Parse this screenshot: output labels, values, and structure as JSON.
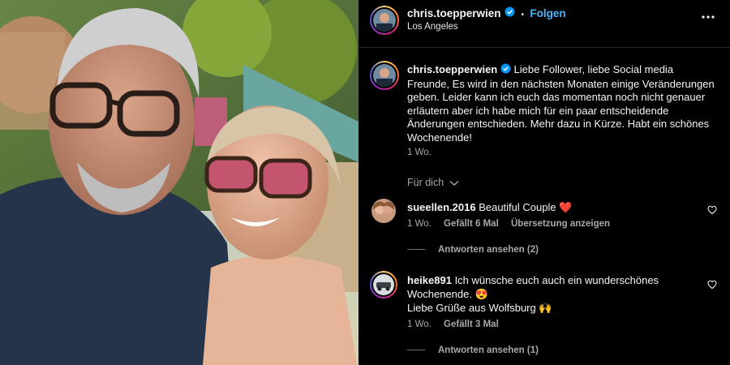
{
  "post": {
    "author": "chris.toepperwien",
    "follow_label": "Folgen",
    "separator": "•",
    "location": "Los Angeles",
    "more_label": "•••"
  },
  "caption": {
    "author": "chris.toepperwien",
    "text": "Liebe Follower, liebe Social media Freunde, Es wird in den nächsten Monaten einige Veränderungen geben. Leider kann ich euch das momentan noch nicht genauer erläutern aber ich habe mich für ein paar entscheidende Änderungen entschieden. Mehr dazu in Kürze. Habt ein schönes Wochenende!",
    "time": "1 Wo."
  },
  "for_you": "Für dich",
  "comments": [
    {
      "user": "sueellen.2016",
      "text": "Beautiful Couple ❤️",
      "time": "1 Wo.",
      "likes": "Gefällt 6 Mal",
      "translate": "Übersetzung anzeigen",
      "replies": "Antworten ansehen (2)"
    },
    {
      "user": "heike891",
      "text_line1": "Ich wünsche euch auch ein wunderschönes",
      "text_line2": "Wochenende. 😍",
      "text_line3": "Liebe Grüße aus Wolfsburg 🙌",
      "time": "1 Wo.",
      "likes": "Gefällt 3 Mal",
      "replies": "Antworten ansehen (1)"
    }
  ],
  "colors": {
    "background": "#000000",
    "text": "#f5f5f5",
    "secondary": "#a8a8a8",
    "link_blue": "#4cb5f9",
    "verified_blue": "#0095f6"
  }
}
